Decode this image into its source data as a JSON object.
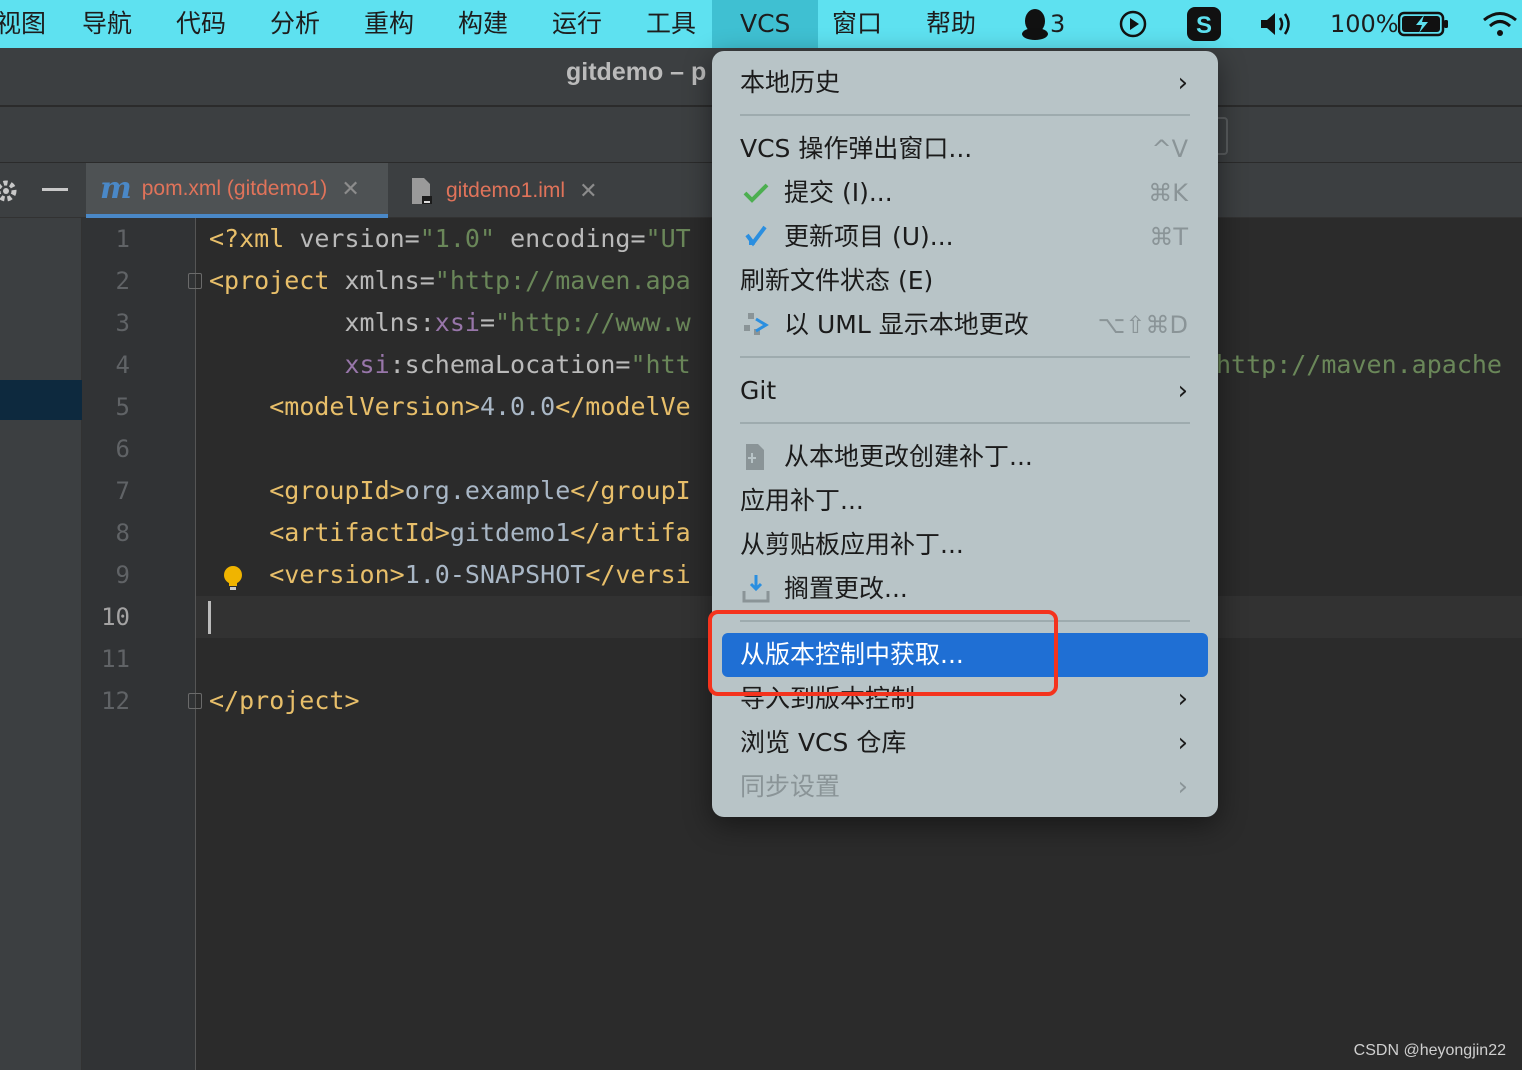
{
  "menubar": {
    "items": [
      "视图",
      "导航",
      "代码",
      "分析",
      "重构",
      "构建",
      "运行",
      "工具",
      "VCS",
      "窗口",
      "帮助"
    ],
    "qq_count": "3",
    "battery": "100%"
  },
  "window": {
    "title": "gitdemo – p"
  },
  "tabs": [
    {
      "label": "pom.xml (gitdemo1)",
      "icon": "maven-m-icon"
    },
    {
      "label": "gitdemo1.iml",
      "icon": "module-file-icon"
    }
  ],
  "editor": {
    "line_numbers": [
      "1",
      "2",
      "3",
      "4",
      "5",
      "6",
      "7",
      "8",
      "9",
      "10",
      "11",
      "12"
    ],
    "current_line": "10",
    "lines": [
      {
        "tag_open": "<?xml ",
        "a1": "version",
        "eq": "=",
        "v1": "\"1.0\"",
        "sp": " ",
        "a2": "encoding",
        "eq2": "=",
        "v2": "\"UT"
      },
      {
        "tag_open": "<project ",
        "a1": "xmlns",
        "eq": "=",
        "v1": "\"http://maven.apa"
      },
      {
        "pad": "         ",
        "a1": "xmlns:",
        "ns": "xsi",
        "eq": "=",
        "v1": "\"http://www.w"
      },
      {
        "pad": "         ",
        "ns": "xsi",
        "a1": ":schemaLocation",
        "eq": "=",
        "v1": "\"htt",
        "tail": "http://maven.apache"
      },
      {
        "pad": "    ",
        "tag": "<modelVersion>",
        "txt": "4.0.0",
        "tag2": "</modelVe"
      },
      {},
      {
        "pad": "    ",
        "tag": "<groupId>",
        "txt": "org.example",
        "tag2": "</groupI"
      },
      {
        "pad": "    ",
        "tag": "<artifactId>",
        "txt": "gitdemo1",
        "tag2": "</artifa"
      },
      {
        "pad": "    ",
        "tag": "<version>",
        "txt": "1.0-SNAPSHOT",
        "tag2": "</versi"
      },
      {},
      {},
      {
        "tag": "</project>"
      }
    ]
  },
  "vcs_menu": {
    "local_history": "本地历史",
    "vcs_popup": "VCS 操作弹出窗口...",
    "vcs_popup_sc": "^V",
    "commit": "提交 (I)...",
    "commit_sc": "⌘K",
    "update": "更新项目 (U)...",
    "update_sc": "⌘T",
    "refresh": "刷新文件状态 (E)",
    "uml": "以 UML 显示本地更改",
    "uml_sc": "⌥⇧⌘D",
    "git": "Git",
    "create_patch": "从本地更改创建补丁...",
    "apply_patch": "应用补丁...",
    "apply_clip": "从剪贴板应用补丁...",
    "shelve": "搁置更改...",
    "get_from_vcs": "从版本控制中获取...",
    "import_vcs": "导入到版本控制",
    "browse_vcs": "浏览 VCS 仓库",
    "sync": "同步设置"
  },
  "watermark": "CSDN @heyongjin22",
  "colors": {
    "menubar": "#5ee1f0",
    "highlight": "#1f6fd4",
    "annotation": "#f4331d"
  }
}
